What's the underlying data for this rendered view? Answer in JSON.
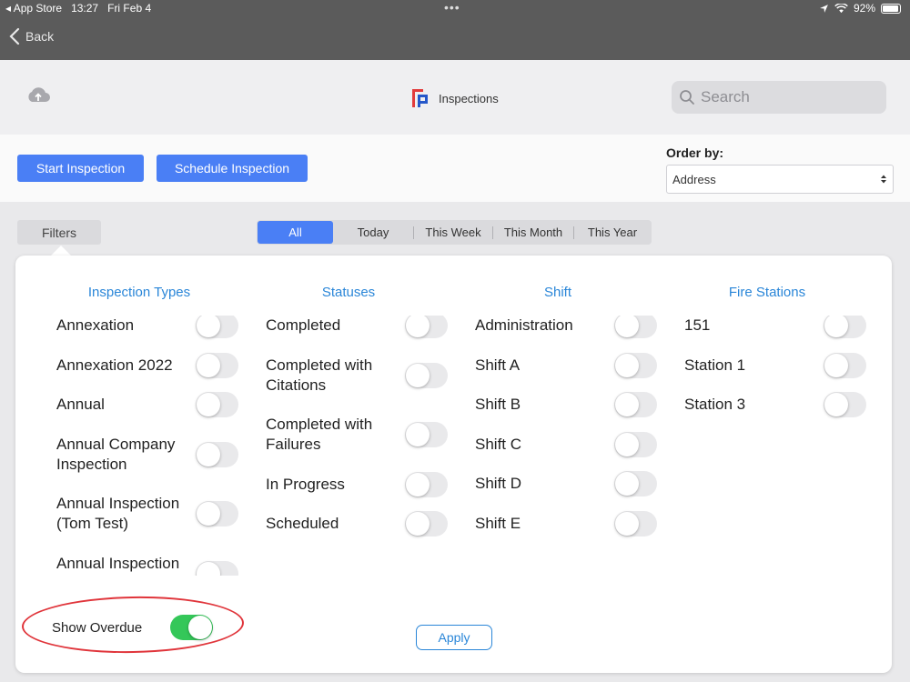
{
  "status_bar": {
    "app_store": "App Store",
    "time": "13:27",
    "date": "Fri Feb 4",
    "dots": "•••",
    "battery": "92%"
  },
  "nav": {
    "back": "Back"
  },
  "header": {
    "title": "Inspections",
    "search_placeholder": "Search"
  },
  "toolbar": {
    "start_label": "Start Inspection",
    "schedule_label": "Schedule Inspection",
    "order_label": "Order by:",
    "order_value": "Address"
  },
  "filters": {
    "tab_label": "Filters"
  },
  "periods": [
    "All",
    "Today",
    "This Week",
    "This Month",
    "This Year"
  ],
  "columns": [
    {
      "heading": "Inspection Types",
      "items": [
        {
          "label": "Annexation",
          "on": false
        },
        {
          "label": "Annexation 2022",
          "on": false
        },
        {
          "label": "Annual",
          "on": false
        },
        {
          "label": "Annual Company Inspection",
          "on": false
        },
        {
          "label": "Annual Inspection (Tom Test)",
          "on": false
        },
        {
          "label": "Annual Inspection",
          "on": false
        }
      ]
    },
    {
      "heading": "Statuses",
      "items": [
        {
          "label": "Completed",
          "on": false
        },
        {
          "label": "Completed with Citations",
          "on": false
        },
        {
          "label": "Completed with Failures",
          "on": false
        },
        {
          "label": "In Progress",
          "on": false
        },
        {
          "label": "Scheduled",
          "on": false
        }
      ]
    },
    {
      "heading": "Shift",
      "items": [
        {
          "label": "Administration",
          "on": false
        },
        {
          "label": "Shift A",
          "on": false
        },
        {
          "label": "Shift B",
          "on": false
        },
        {
          "label": "Shift C",
          "on": false
        },
        {
          "label": "Shift D",
          "on": false
        },
        {
          "label": "Shift E",
          "on": false
        }
      ]
    },
    {
      "heading": "Fire Stations",
      "items": [
        {
          "label": "151",
          "on": false
        },
        {
          "label": "Station 1",
          "on": false
        },
        {
          "label": "Station 3",
          "on": false
        }
      ]
    }
  ],
  "overdue": {
    "label": "Show Overdue",
    "on": true
  },
  "apply_label": "Apply",
  "colors": {
    "accent": "#4a7ff5",
    "link": "#2a86d8",
    "toggle_on": "#34c759",
    "highlight": "#e0353b"
  }
}
